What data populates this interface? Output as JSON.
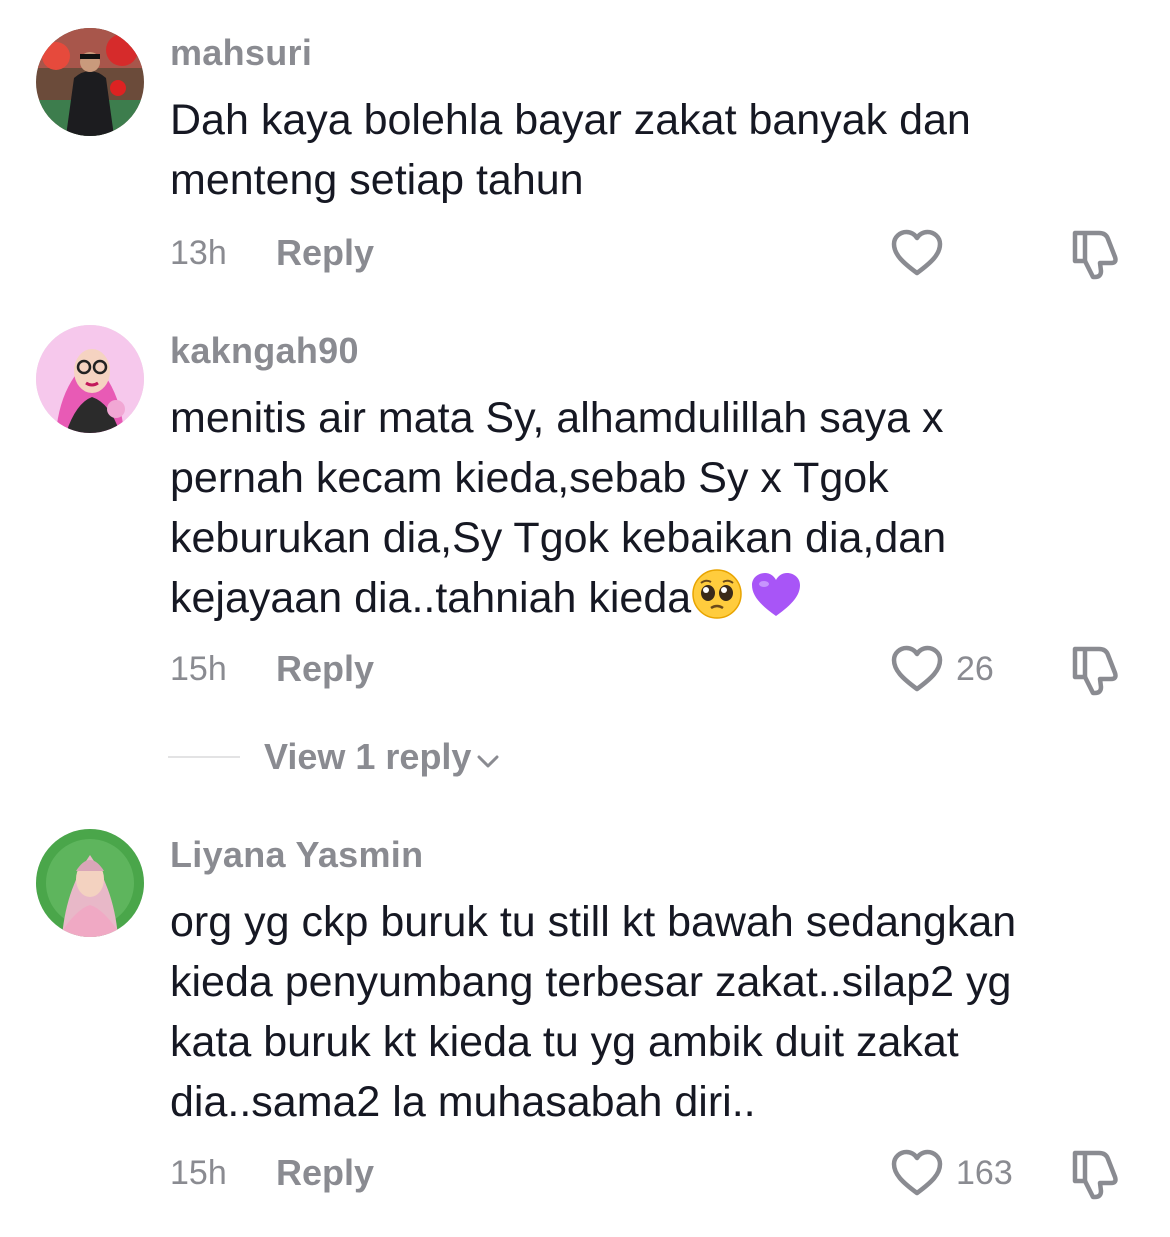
{
  "comments": [
    {
      "username": "mahsuri",
      "text_lines": [
        "Dah kaya bolehla bayar zakat banyak dan",
        "menteng setiap tahun"
      ],
      "time": "13h",
      "reply_label": "Reply",
      "like_count": ""
    },
    {
      "username": "kakngah90",
      "text_lines": [
        "menitis air mata Sy, alhamdulillah saya x",
        "pernah kecam kieda,sebab Sy x Tgok",
        "keburukan dia,Sy Tgok kebaikan dia,dan",
        "kejayaan dia..tahniah kieda"
      ],
      "time": "15h",
      "reply_label": "Reply",
      "like_count": "26",
      "view_replies": "View 1 reply"
    },
    {
      "username": "Liyana Yasmin",
      "text_lines": [
        "org yg ckp buruk tu still kt bawah sedangkan",
        "kieda penyumbang terbesar zakat..silap2 yg",
        "kata buruk kt kieda tu yg ambik duit zakat",
        "dia..sama2 la muhasabah diri.."
      ],
      "time": "15h",
      "reply_label": "Reply",
      "like_count": "163"
    }
  ],
  "icons": {
    "like": "heart-outline-icon",
    "dislike": "thumbs-down-icon",
    "emoji_1": "pleading-face-emoji",
    "emoji_2": "purple-heart-emoji",
    "chevron": "chevron-down-icon"
  },
  "colors": {
    "text_primary": "#161823",
    "text_secondary": "#8a8b91",
    "purple_heart": "#a855f7"
  }
}
